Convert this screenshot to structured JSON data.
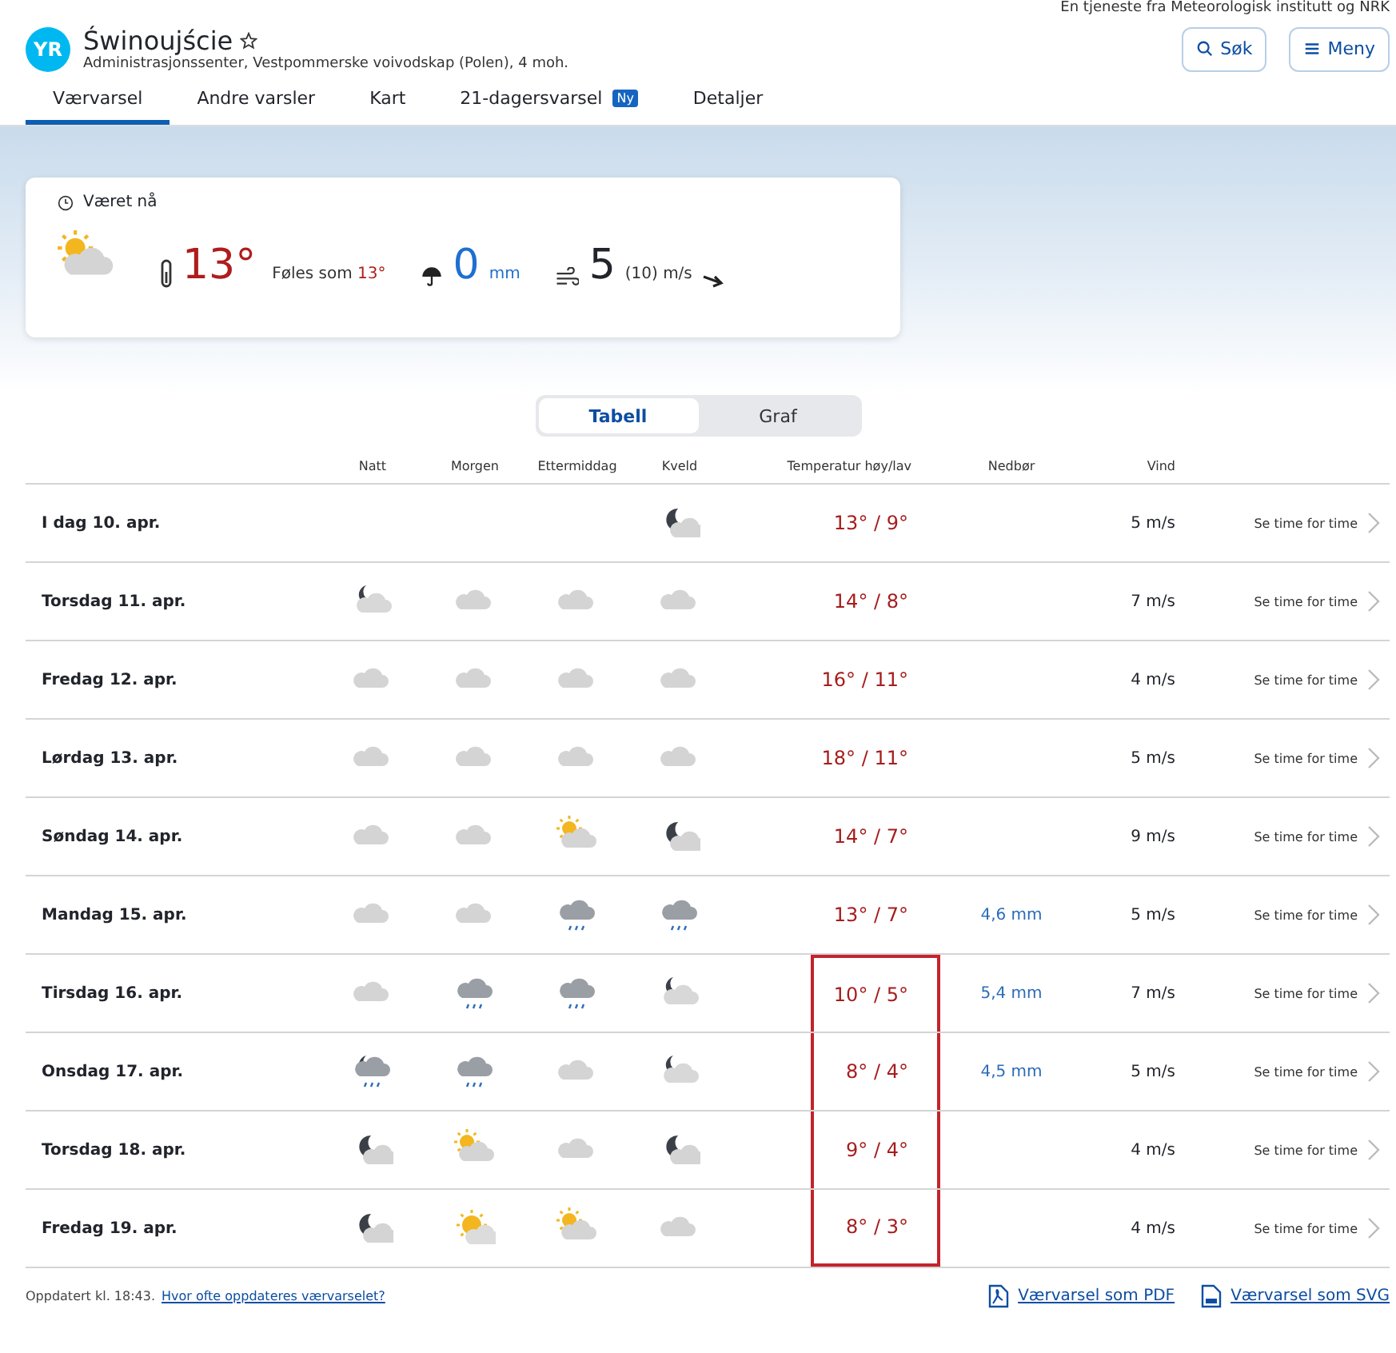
{
  "tagline": "En tjeneste fra Meteorologisk institutt og NRK",
  "header": {
    "logo": "YR",
    "title": "Świnoujście",
    "subtitle": "Administrasjonssenter, Vestpommerske voivodskap (Polen), 4 moh.",
    "buttons": [
      {
        "label": "Søk",
        "kind": "search"
      },
      {
        "label": "Meny",
        "kind": "menu"
      }
    ]
  },
  "tabs": [
    {
      "label": "Værvarsel",
      "selected": true
    },
    {
      "label": "Andre varsler",
      "selected": false
    },
    {
      "label": "Kart",
      "selected": false
    },
    {
      "label": "21-dagersvarsel",
      "selected": false,
      "badge": "Ny"
    },
    {
      "label": "Detaljer",
      "selected": false
    }
  ],
  "now": {
    "title": "Været nå",
    "symbol": {
      "kind": "partly-day"
    },
    "temperature": "13°",
    "feels_label": "Føles som",
    "feels_value": "13°",
    "precip_value": "0",
    "precip_unit": "mm",
    "wind_value": "5",
    "wind_detail": "(10) m/s"
  },
  "view_toggle": [
    {
      "label": "Tabell",
      "selected": true
    },
    {
      "label": "Graf",
      "selected": false
    }
  ],
  "table": {
    "columns": [
      "Natt",
      "Morgen",
      "Ettermiddag",
      "Kveld",
      "Temperatur høy/lav",
      "Nedbør",
      "Vind"
    ],
    "rows": [
      {
        "day": "I dag 10. apr.",
        "symbols": {
          "kveld": {
            "kind": "fair-night"
          }
        },
        "temperature": "13° / 9°",
        "wind": "5 m/s",
        "link": "Se time for time",
        "highlighted": false
      },
      {
        "day": "Torsdag 11. apr.",
        "symbols": {
          "natt": {
            "kind": "partly-night"
          },
          "morgen": {
            "kind": "cloudy"
          },
          "ettermiddag": {
            "kind": "cloudy"
          },
          "kveld": {
            "kind": "cloudy"
          }
        },
        "temperature": "14° / 8°",
        "wind": "7 m/s",
        "link": "Se time for time",
        "highlighted": false
      },
      {
        "day": "Fredag 12. apr.",
        "symbols": {
          "natt": {
            "kind": "cloudy"
          },
          "morgen": {
            "kind": "cloudy"
          },
          "ettermiddag": {
            "kind": "cloudy"
          },
          "kveld": {
            "kind": "cloudy"
          }
        },
        "temperature": "16° / 11°",
        "wind": "4 m/s",
        "link": "Se time for time",
        "highlighted": false
      },
      {
        "day": "Lørdag 13. apr.",
        "symbols": {
          "natt": {
            "kind": "cloudy"
          },
          "morgen": {
            "kind": "cloudy"
          },
          "ettermiddag": {
            "kind": "cloudy"
          },
          "kveld": {
            "kind": "cloudy"
          }
        },
        "temperature": "18° / 11°",
        "wind": "5 m/s",
        "link": "Se time for time",
        "highlighted": false
      },
      {
        "day": "Søndag 14. apr.",
        "symbols": {
          "natt": {
            "kind": "cloudy"
          },
          "morgen": {
            "kind": "cloudy"
          },
          "ettermiddag": {
            "kind": "partly-day"
          },
          "kveld": {
            "kind": "fair-night"
          }
        },
        "temperature": "14° / 7°",
        "wind": "9 m/s",
        "link": "Se time for time",
        "highlighted": false
      },
      {
        "day": "Mandag 15. apr.",
        "symbols": {
          "natt": {
            "kind": "cloudy"
          },
          "morgen": {
            "kind": "cloudy"
          },
          "ettermiddag": {
            "kind": "rain"
          },
          "kveld": {
            "kind": "rain"
          }
        },
        "temperature": "13° / 7°",
        "precipitation": "4,6 mm",
        "wind": "5 m/s",
        "link": "Se time for time",
        "highlighted": false
      },
      {
        "day": "Tirsdag 16. apr.",
        "symbols": {
          "natt": {
            "kind": "cloudy"
          },
          "morgen": {
            "kind": "rain"
          },
          "ettermiddag": {
            "kind": "rain"
          },
          "kveld": {
            "kind": "partly-night"
          }
        },
        "temperature": "10° / 5°",
        "precipitation": "5,4 mm",
        "wind": "7 m/s",
        "link": "Se time for time",
        "highlighted": true
      },
      {
        "day": "Onsdag 17. apr.",
        "symbols": {
          "natt": {
            "kind": "rain-night"
          },
          "morgen": {
            "kind": "rain"
          },
          "ettermiddag": {
            "kind": "cloudy"
          },
          "kveld": {
            "kind": "partly-night"
          }
        },
        "temperature": "8° / 4°",
        "precipitation": "4,5 mm",
        "wind": "5 m/s",
        "link": "Se time for time",
        "highlighted": true
      },
      {
        "day": "Torsdag 18. apr.",
        "symbols": {
          "natt": {
            "kind": "fair-night"
          },
          "morgen": {
            "kind": "partly-day"
          },
          "ettermiddag": {
            "kind": "cloudy"
          },
          "kveld": {
            "kind": "fair-night"
          }
        },
        "temperature": "9° / 4°",
        "wind": "4 m/s",
        "link": "Se time for time",
        "highlighted": true
      },
      {
        "day": "Fredag 19. apr.",
        "symbols": {
          "natt": {
            "kind": "fair-night"
          },
          "morgen": {
            "kind": "fair-day"
          },
          "ettermiddag": {
            "kind": "partly-day"
          },
          "kveld": {
            "kind": "cloudy"
          }
        },
        "temperature": "8° / 3°",
        "wind": "4 m/s",
        "link": "Se time for time",
        "highlighted": true
      }
    ]
  },
  "footer": {
    "updated": "Oppdatert kl. 18:43.",
    "help_link": "Hvor ofte oppdateres værvarselet?",
    "downloads": [
      {
        "label": "Værvarsel som PDF",
        "kind": "pdf"
      },
      {
        "label": "Værvarsel som SVG",
        "kind": "svg"
      }
    ]
  }
}
